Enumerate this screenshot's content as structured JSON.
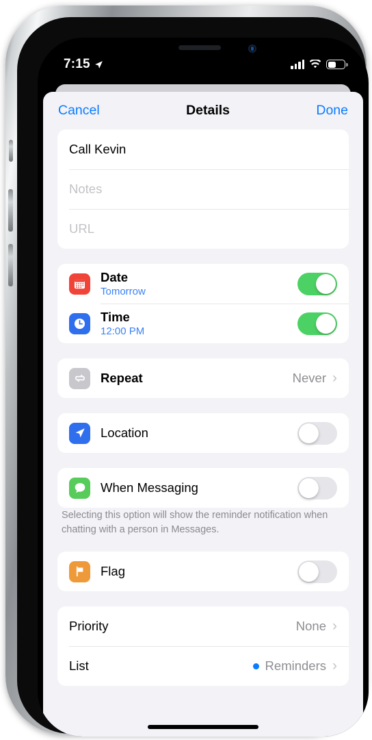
{
  "status_bar": {
    "time": "7:15",
    "location_icon": "location-arrow-icon",
    "cellular_icon": "cellular-signal-icon",
    "wifi_icon": "wifi-icon",
    "battery_icon": "battery-icon",
    "battery_level_percent": 45
  },
  "nav": {
    "cancel_label": "Cancel",
    "title": "Details",
    "done_label": "Done"
  },
  "fields": {
    "title_value": "Call Kevin",
    "notes_placeholder": "Notes",
    "url_placeholder": "URL"
  },
  "rows": {
    "date": {
      "label": "Date",
      "sub": "Tomorrow",
      "icon": "calendar-icon",
      "icon_color": "#f04438",
      "toggle": "on"
    },
    "time": {
      "label": "Time",
      "sub": "12:00 PM",
      "icon": "clock-icon",
      "icon_color": "#2f6fed",
      "toggle": "on"
    },
    "repeat": {
      "label": "Repeat",
      "value": "Never",
      "icon": "repeat-icon",
      "icon_color": "#c7c7cc",
      "chevron": "chevron-right-icon"
    },
    "location": {
      "label": "Location",
      "icon": "location-arrow-icon",
      "icon_color": "#2f6fed",
      "toggle": "off"
    },
    "when_messaging": {
      "label": "When Messaging",
      "icon": "message-bubble-icon",
      "icon_color": "#57cc5a",
      "toggle": "off"
    },
    "flag": {
      "label": "Flag",
      "icon": "flag-icon",
      "icon_color": "#ef9a3a",
      "toggle": "off"
    },
    "priority": {
      "label": "Priority",
      "value": "None",
      "chevron": "chevron-right-icon"
    },
    "list": {
      "label": "List",
      "value": "Reminders",
      "dot_color": "#0a7cff",
      "chevron": "chevron-right-icon"
    }
  },
  "footnote": "Selecting this option will show the reminder notification when chatting with a person in Messages.",
  "chevron_glyph": "›",
  "colors": {
    "accent_blue": "#0a7cff",
    "toggle_on_green": "#4cd264",
    "toggle_off_gray": "#e5e5ea",
    "sheet_bg": "#f2f2f7"
  }
}
